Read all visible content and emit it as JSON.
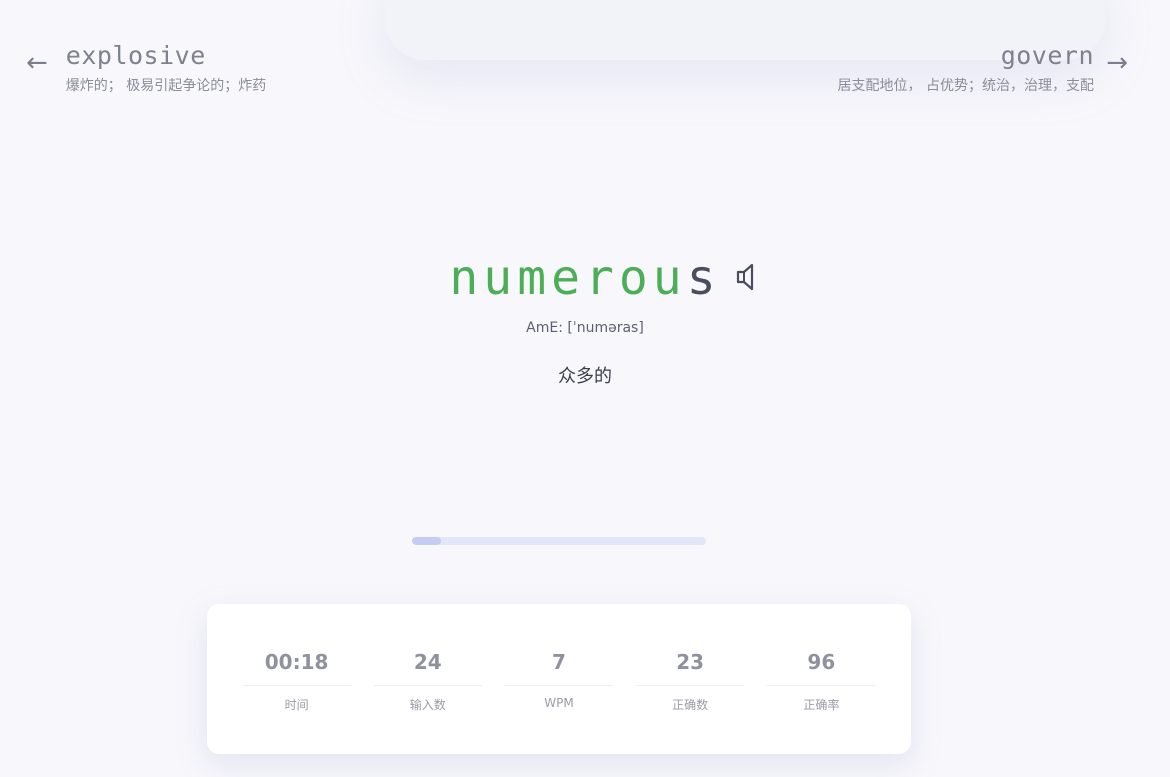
{
  "prev_word": {
    "word": "explosive",
    "translation": "爆炸的； 极易引起争论的；炸药",
    "arrow_icon": "arrow-left-icon"
  },
  "next_word": {
    "word": "govern",
    "translation": "居支配地位， 占优势；统治，治理，支配",
    "arrow_icon": "arrow-right-icon"
  },
  "current": {
    "typed": "numerou",
    "pending": "s",
    "phonetic": "AmE: [ˈnuməras]",
    "meaning": "众多的",
    "speaker_icon": "speaker-icon"
  },
  "progress": {
    "fraction": 0.1
  },
  "stats": [
    {
      "value": "00:18",
      "label": "时间"
    },
    {
      "value": "24",
      "label": "输入数"
    },
    {
      "value": "7",
      "label": "WPM"
    },
    {
      "value": "23",
      "label": "正确数"
    },
    {
      "value": "96",
      "label": "正确率"
    }
  ],
  "colors": {
    "typed": "#4caf58",
    "pending": "#4a4d5e",
    "progress_fill": "#c6cdf4",
    "progress_track": "#e3e6f7"
  }
}
